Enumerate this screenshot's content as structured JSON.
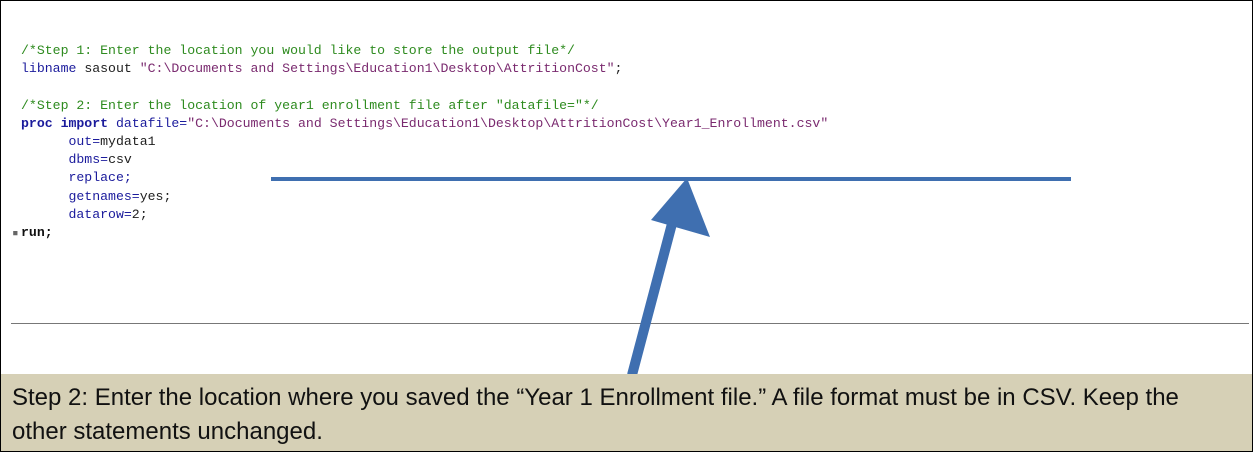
{
  "code_lines": [
    {
      "parts": [
        {
          "cls": "cm",
          "t": "/*Step 1: Enter the location you would like to store the output file*/"
        }
      ]
    },
    {
      "parts": [
        {
          "cls": "kwn",
          "t": "libname"
        },
        {
          "cls": "plain",
          "t": " sasout "
        },
        {
          "cls": "str",
          "t": "\"C:\\Documents and Settings\\Education1\\Desktop\\AttritionCost\""
        },
        {
          "cls": "plain",
          "t": ";"
        }
      ]
    },
    {
      "parts": []
    },
    {
      "parts": [
        {
          "cls": "cm",
          "t": "/*Step 2: Enter the location of year1 enrollment file after \"datafile=\"*/"
        }
      ]
    },
    {
      "parts": [
        {
          "cls": "kw",
          "t": "proc import"
        },
        {
          "cls": "plain",
          "t": " "
        },
        {
          "cls": "kwn",
          "t": "datafile="
        },
        {
          "cls": "str",
          "t": "\"C:\\Documents and Settings\\Education1\\Desktop\\AttritionCost\\Year1_Enrollment.csv\""
        }
      ]
    },
    {
      "parts": [
        {
          "cls": "plain",
          "t": "      "
        },
        {
          "cls": "kwn",
          "t": "out="
        },
        {
          "cls": "plain",
          "t": "mydata1"
        }
      ]
    },
    {
      "parts": [
        {
          "cls": "plain",
          "t": "      "
        },
        {
          "cls": "kwn",
          "t": "dbms="
        },
        {
          "cls": "plain",
          "t": "csv"
        }
      ]
    },
    {
      "parts": [
        {
          "cls": "plain",
          "t": "      "
        },
        {
          "cls": "kwn",
          "t": "replace;"
        }
      ]
    },
    {
      "parts": [
        {
          "cls": "plain",
          "t": "      "
        },
        {
          "cls": "kwn",
          "t": "getnames="
        },
        {
          "cls": "plain",
          "t": "yes;"
        }
      ]
    },
    {
      "parts": [
        {
          "cls": "plain",
          "t": "      "
        },
        {
          "cls": "kwn",
          "t": "datarow="
        },
        {
          "cls": "plain",
          "t": "2;"
        }
      ]
    },
    {
      "parts": [
        {
          "cls": "bold",
          "t": "run;"
        }
      ]
    }
  ],
  "note": {
    "text": "Step 2: Enter the location where you saved the “Year 1 Enrollment file.” A file format must be in CSV. Keep the other statements unchanged."
  },
  "colors": {
    "comment": "#2e8b1f",
    "keyword": "#1b1b9c",
    "string": "#7a2a6f",
    "arrow": "#3f6fb0",
    "note_bg": "#d6d0b6"
  }
}
